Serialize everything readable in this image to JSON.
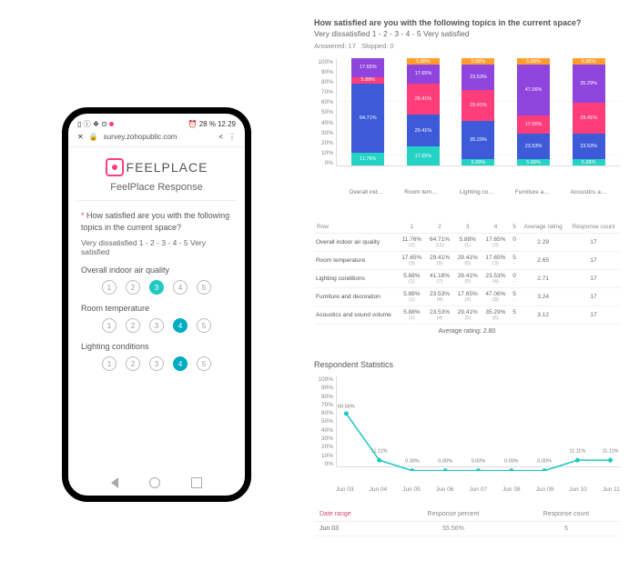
{
  "phone": {
    "status": {
      "left": "▯ ⓘ ❖ ⊙",
      "battery": "28 %",
      "time": "12.29",
      "alarm": "⏰"
    },
    "url": "survey.zohopublic.com",
    "logo": "FEELPLACE",
    "form_title": "FeelPlace Response",
    "question": "How satisfied are you with the following topics in the current space?",
    "scale_hint": "Very dissatisfied  1 - 2 - 3 - 4 - 5 Very satisfied",
    "fields": [
      {
        "label": "Overall indoor air quality",
        "selected": 3
      },
      {
        "label": "Room temperature",
        "selected": 4
      },
      {
        "label": "Lighting conditions",
        "selected": 4
      }
    ]
  },
  "report": {
    "question": "How satisfied are you with the following topics in the current space?",
    "scale": "Very dissatisfied  1 - 2 - 3 - 4 - 5 Very satisfied",
    "answered": "Answered: 17",
    "skipped": "Skipped: 0",
    "y_ticks": [
      "100%",
      "90%",
      "80%",
      "70%",
      "60%",
      "50%",
      "40%",
      "30%",
      "20%",
      "10%",
      "0%"
    ]
  },
  "chart_data": {
    "type": "bar-stacked",
    "ylim": [
      0,
      100
    ],
    "categories": [
      "Overall indoor a…",
      "Room temperat…",
      "Lighting conditi…",
      "Furniture and d…",
      "Acoustics and …"
    ],
    "series_names": [
      "1",
      "2",
      "3",
      "4",
      "5"
    ],
    "colors": [
      "#24d3c4",
      "#3d5bd9",
      "#ff3d7a",
      "#8e44dd",
      "#ff9e2e"
    ],
    "stacks": [
      [
        11.76,
        64.71,
        5.88,
        17.65,
        0.0
      ],
      [
        17.65,
        29.41,
        29.41,
        17.65,
        5.88
      ],
      [
        5.88,
        35.29,
        29.41,
        23.53,
        5.88
      ],
      [
        5.88,
        23.53,
        17.65,
        47.06,
        5.88
      ],
      [
        5.88,
        23.53,
        29.41,
        35.29,
        5.88
      ]
    ]
  },
  "table": {
    "headers": [
      "Row",
      "1",
      "2",
      "3",
      "4",
      "5",
      "Average rating",
      "Response count"
    ],
    "rows": [
      {
        "label": "Overall indoor air quality",
        "cells": [
          [
            "11.76%",
            "(2)"
          ],
          [
            "64.71%",
            "(11)"
          ],
          [
            "5.88%",
            "(1)"
          ],
          [
            "17.65%",
            "(3)"
          ],
          [
            "0",
            "-"
          ]
        ],
        "avg": "2.29",
        "count": "17"
      },
      {
        "label": "Room temperature",
        "cells": [
          [
            "17.65%",
            "(3)"
          ],
          [
            "29.41%",
            "(5)"
          ],
          [
            "29.41%",
            "(5)"
          ],
          [
            "17.65%",
            "(3)"
          ],
          [
            "5",
            "-"
          ]
        ],
        "avg": "2.65",
        "count": "17"
      },
      {
        "label": "Lighting conditions",
        "cells": [
          [
            "5.88%",
            "(1)"
          ],
          [
            "41.18%",
            "(7)"
          ],
          [
            "29.41%",
            "(5)"
          ],
          [
            "23.53%",
            "(4)"
          ],
          [
            "0",
            "-"
          ]
        ],
        "avg": "2.71",
        "count": "17"
      },
      {
        "label": "Furniture and decoration",
        "cells": [
          [
            "5.88%",
            "(1)"
          ],
          [
            "23.53%",
            "(4)"
          ],
          [
            "17.65%",
            "(3)"
          ],
          [
            "47.06%",
            "(8)"
          ],
          [
            "5",
            "-"
          ]
        ],
        "avg": "3.24",
        "count": "17"
      },
      {
        "label": "Acoustics and sound volume",
        "cells": [
          [
            "5.88%",
            "(1)"
          ],
          [
            "23.53%",
            "(4)"
          ],
          [
            "29.41%",
            "(5)"
          ],
          [
            "35.29%",
            "(6)"
          ],
          [
            "5",
            "-"
          ]
        ],
        "avg": "3.12",
        "count": "17"
      }
    ],
    "avg_all": "Average rating: 2.80"
  },
  "respondent": {
    "title": "Respondent Statistics",
    "y_ticks": [
      "100%",
      "90%",
      "80%",
      "70%",
      "60%",
      "50%",
      "40%",
      "30%",
      "20%",
      "10%",
      "0%"
    ],
    "x": [
      "Jun 03",
      "Jun 04",
      "Jun 05",
      "Jun 06",
      "Jun 07",
      "Jun 08",
      "Jun 09",
      "Jun 10",
      "Jun 11"
    ],
    "values": [
      60.56,
      11.11,
      0.0,
      0.0,
      0.0,
      0.0,
      0.0,
      11.11,
      11.11
    ],
    "labels": [
      "60.56%",
      "11.11%",
      "0.00%",
      "0.00%",
      "0.00%",
      "0.00%",
      "0.00%",
      "11.11%",
      "11.11%"
    ]
  },
  "date_table": {
    "headers": [
      "Date range",
      "Response percent",
      "Response count"
    ],
    "row": [
      "Jun 03",
      "55.56%",
      "5"
    ]
  }
}
